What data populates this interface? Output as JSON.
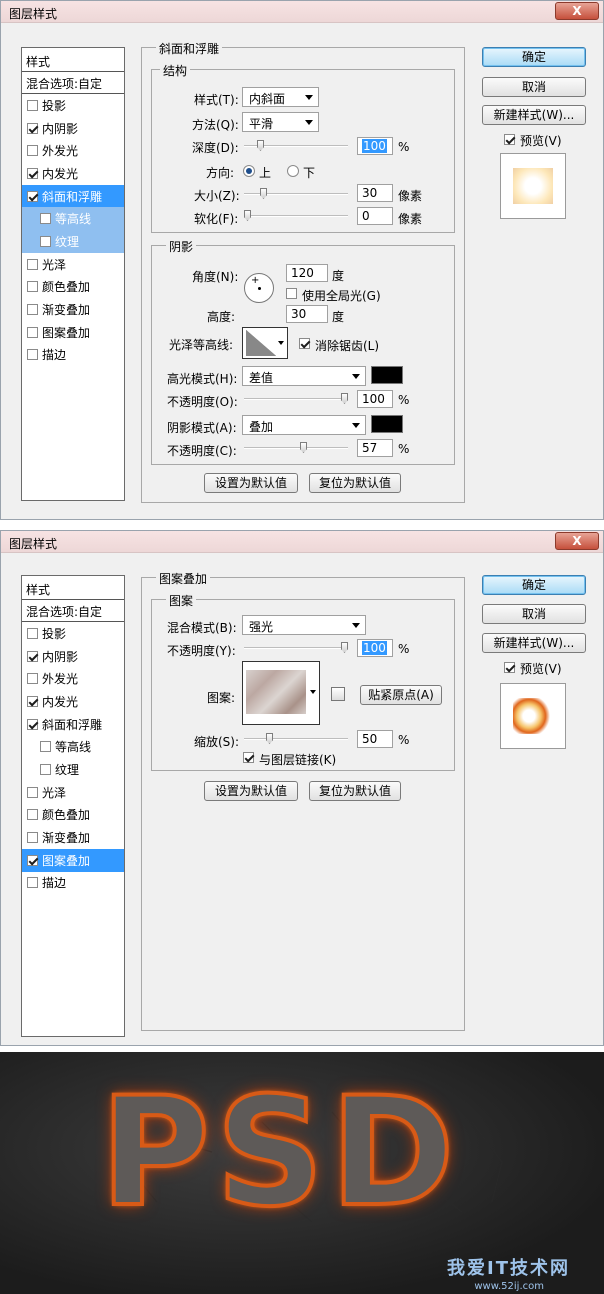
{
  "dialog1": {
    "title": "图层样式",
    "close": "X",
    "styles_header": "样式",
    "blend_options": "混合选项:自定",
    "styles": [
      {
        "label": "投影",
        "checked": false
      },
      {
        "label": "内阴影",
        "checked": true
      },
      {
        "label": "外发光",
        "checked": false
      },
      {
        "label": "内发光",
        "checked": true
      },
      {
        "label": "斜面和浮雕",
        "checked": true
      },
      {
        "label": "等高线",
        "checked": false
      },
      {
        "label": "纹理",
        "checked": false
      },
      {
        "label": "光泽",
        "checked": false
      },
      {
        "label": "颜色叠加",
        "checked": false
      },
      {
        "label": "渐变叠加",
        "checked": false
      },
      {
        "label": "图案叠加",
        "checked": false
      },
      {
        "label": "描边",
        "checked": false
      }
    ],
    "section_title": "斜面和浮雕",
    "structure": {
      "title": "结构",
      "style_label": "样式(T):",
      "style_value": "内斜面",
      "technique_label": "方法(Q):",
      "technique_value": "平滑",
      "depth_label": "深度(D):",
      "depth_value": "100",
      "depth_unit": "%",
      "direction_label": "方向:",
      "direction_up": "上",
      "direction_down": "下",
      "size_label": "大小(Z):",
      "size_value": "30",
      "size_unit": "像素",
      "soften_label": "软化(F):",
      "soften_value": "0",
      "soften_unit": "像素"
    },
    "shading": {
      "title": "阴影",
      "angle_label": "角度(N):",
      "angle_value": "120",
      "angle_unit": "度",
      "global_light": "使用全局光(G)",
      "altitude_label": "高度:",
      "altitude_value": "30",
      "altitude_unit": "度",
      "gloss_label": "光泽等高线:",
      "anti_alias": "消除锯齿(L)",
      "highlight_mode_label": "高光模式(H):",
      "highlight_mode_value": "差值",
      "highlight_opacity_label": "不透明度(O):",
      "highlight_opacity_value": "100",
      "shadow_mode_label": "阴影模式(A):",
      "shadow_mode_value": "叠加",
      "shadow_opacity_label": "不透明度(C):",
      "shadow_opacity_value": "57",
      "percent": "%"
    },
    "make_default": "设置为默认值",
    "reset_default": "复位为默认值",
    "ok": "确定",
    "cancel": "取消",
    "new_style": "新建样式(W)...",
    "preview": "预览(V)"
  },
  "dialog2": {
    "title": "图层样式",
    "close": "X",
    "styles_header": "样式",
    "blend_options": "混合选项:自定",
    "styles": [
      {
        "label": "投影",
        "checked": false
      },
      {
        "label": "内阴影",
        "checked": true
      },
      {
        "label": "外发光",
        "checked": false
      },
      {
        "label": "内发光",
        "checked": true
      },
      {
        "label": "斜面和浮雕",
        "checked": true
      },
      {
        "label": "等高线",
        "checked": false
      },
      {
        "label": "纹理",
        "checked": false
      },
      {
        "label": "光泽",
        "checked": false
      },
      {
        "label": "颜色叠加",
        "checked": false
      },
      {
        "label": "渐变叠加",
        "checked": false
      },
      {
        "label": "图案叠加",
        "checked": true
      },
      {
        "label": "描边",
        "checked": false
      }
    ],
    "section_title": "图案叠加",
    "pattern": {
      "title": "图案",
      "blend_label": "混合模式(B):",
      "blend_value": "强光",
      "opacity_label": "不透明度(Y):",
      "opacity_value": "100",
      "pattern_label": "图案:",
      "snap": "贴紧原点(A)",
      "scale_label": "缩放(S):",
      "scale_value": "50",
      "link": "与图层链接(K)",
      "percent": "%"
    },
    "make_default": "设置为默认值",
    "reset_default": "复位为默认值",
    "ok": "确定",
    "cancel": "取消",
    "new_style": "新建样式(W)...",
    "preview": "预览(V)"
  },
  "result": {
    "text": "PSD",
    "watermark": "我爱IT技术网",
    "watermark_url": "www.52ij.com"
  }
}
